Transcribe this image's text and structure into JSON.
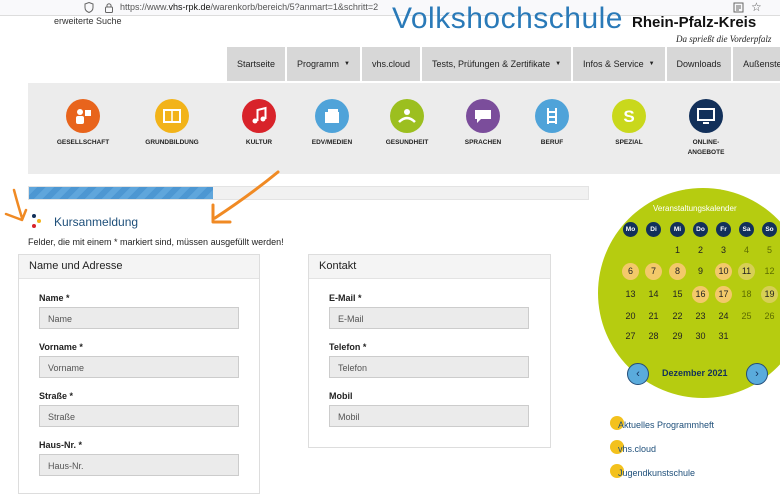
{
  "browser": {
    "url_prefix": "https://www.",
    "url_domain": "vhs-rpk.de",
    "url_path": "/warenkorb/bereich/5?anmart=1&schritt=2"
  },
  "header": {
    "extended_search": "erweiterte Suche",
    "logo_text": "Volkshochschule",
    "region": "Rhein-Pfalz-Kreis",
    "slogan": "Da spriеßt die Vorderpfalz"
  },
  "nav": [
    {
      "label": "Startseite",
      "caret": false
    },
    {
      "label": "Programm",
      "caret": true
    },
    {
      "label": "vhs.cloud",
      "caret": false
    },
    {
      "label": "Tests, Prüfungen & Zertifikate",
      "caret": true
    },
    {
      "label": "Infos & Service",
      "caret": true
    },
    {
      "label": "Downloads",
      "caret": false
    },
    {
      "label": "Außenstellen",
      "caret": false
    }
  ],
  "categories": [
    {
      "label": "GESELLSCHAFT",
      "color": "#e8641c",
      "icon": "people-icon"
    },
    {
      "label": "GRUNDBILDUNG",
      "color": "#f2b319",
      "icon": "book-icon"
    },
    {
      "label": "KULTUR",
      "color": "#d8232a",
      "icon": "music-icon"
    },
    {
      "label": "EDV/MEDIEN",
      "color": "#4fa3d9",
      "icon": "folders-icon"
    },
    {
      "label": "GESUNDHEIT",
      "color": "#9cbf1f",
      "icon": "health-icon"
    },
    {
      "label": "SPRACHEN",
      "color": "#7b4d9b",
      "icon": "speech-icon"
    },
    {
      "label": "BERUF",
      "color": "#4fa3d9",
      "icon": "ladder-icon"
    },
    {
      "label": "SPEZIAL",
      "color": "#c9d81c",
      "icon": "s-icon"
    },
    {
      "label": "ONLINE-\nANGEBOTE",
      "color": "#12305a",
      "icon": "monitor-icon"
    }
  ],
  "progress": {
    "fraction": 0.33
  },
  "section": {
    "title": "Kursanmeldung",
    "required_note": "Felder, die mit einem * markiert sind, müssen ausgefüllt werden!"
  },
  "address_panel": {
    "title": "Name und Adresse",
    "fields": [
      {
        "label": "Name *",
        "placeholder": "Name"
      },
      {
        "label": "Vorname *",
        "placeholder": "Vorname"
      },
      {
        "label": "Straße *",
        "placeholder": "Straße"
      },
      {
        "label": "Haus-Nr. *",
        "placeholder": "Haus-Nr."
      }
    ]
  },
  "contact_panel": {
    "title": "Kontakt",
    "fields": [
      {
        "label": "E-Mail *",
        "placeholder": "E-Mail"
      },
      {
        "label": "Telefon *",
        "placeholder": "Telefon"
      },
      {
        "label": "Mobil",
        "placeholder": "Mobil"
      }
    ]
  },
  "calendar": {
    "title": "Veranstaltungskalender",
    "weekdays": [
      "Mo",
      "Di",
      "Mi",
      "Do",
      "Fr",
      "Sa",
      "So"
    ],
    "weeks": [
      [
        "",
        "",
        "1",
        "2",
        "3",
        "4",
        "5"
      ],
      [
        "6",
        "7",
        "8",
        "9",
        "10",
        "11",
        "12"
      ],
      [
        "13",
        "14",
        "15",
        "16",
        "17",
        "18",
        "19"
      ],
      [
        "20",
        "21",
        "22",
        "23",
        "24",
        "25",
        "26"
      ],
      [
        "27",
        "28",
        "29",
        "30",
        "31",
        "",
        ""
      ]
    ],
    "event_days": [
      "6",
      "7",
      "8",
      "10",
      "11",
      "16",
      "17",
      "19"
    ],
    "muted_days": [
      "4",
      "5",
      "11",
      "12",
      "18",
      "19",
      "25",
      "26"
    ],
    "month_label": "Dezember 2021",
    "prev_label": "‹",
    "next_label": "›"
  },
  "side_links": [
    "Aktuelles Programmheft",
    "vhs.cloud",
    "Jugendkunstschule"
  ],
  "colors": {
    "accent_orange": "#f08a24",
    "brand_blue": "#1e4f7a",
    "calendar_green": "#b6cc10"
  }
}
